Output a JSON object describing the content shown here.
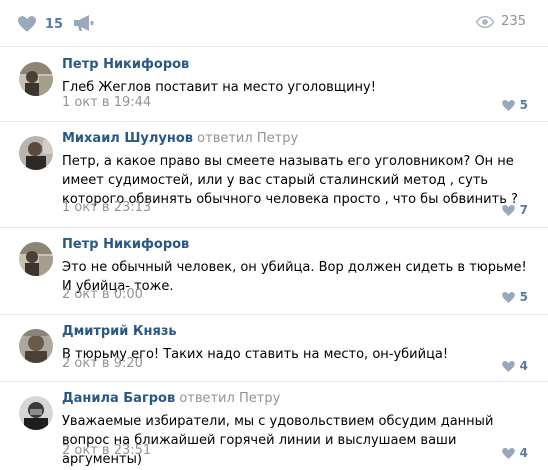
{
  "post_actions": {
    "likes": "15",
    "views": "235"
  },
  "colors": {
    "author_link": "#2a5885",
    "muted": "#939393",
    "like_icon": "#99a8bd",
    "divider": "#e7e8ec"
  },
  "comments": [
    {
      "author": "Петр Никифоров",
      "replied": "",
      "reply_to": "",
      "text": "Глеб Жеглов поставит на место уголовщину!",
      "date": "1 окт в 19:44",
      "likes": "5"
    },
    {
      "author": "Михаил Шулунов",
      "replied": "ответил",
      "reply_to": "Петру",
      "text": "Петр, а какое право вы смеете называть его уголовником? Он не имеет судимостей, или у вас старый сталинский метод , суть которого обвинять обычного человека просто , что бы обвинить ?",
      "date": "1 окт в 23:13",
      "likes": "7"
    },
    {
      "author": "Петр Никифоров",
      "replied": "",
      "reply_to": "",
      "text": "Это не обычный человек, он убийца. Вор должен сидеть в тюрьме! И убийца- тоже.",
      "date": "2 окт в 0:00",
      "likes": "5"
    },
    {
      "author": "Дмитрий Князь",
      "replied": "",
      "reply_to": "",
      "text": "В тюрьму его! Таких надо ставить на место, он-убийца!",
      "date": "2 окт в 9:20",
      "likes": "4"
    },
    {
      "author": "Данила Багров",
      "replied": "ответил",
      "reply_to": "Петру",
      "text": "Уважаемые избиратели, мы с удовольствием обсудим данный вопрос на ближайшей горячей линии и выслушаем ваши аргументы)",
      "date": "2 окт в 23:51",
      "likes": "4"
    }
  ]
}
